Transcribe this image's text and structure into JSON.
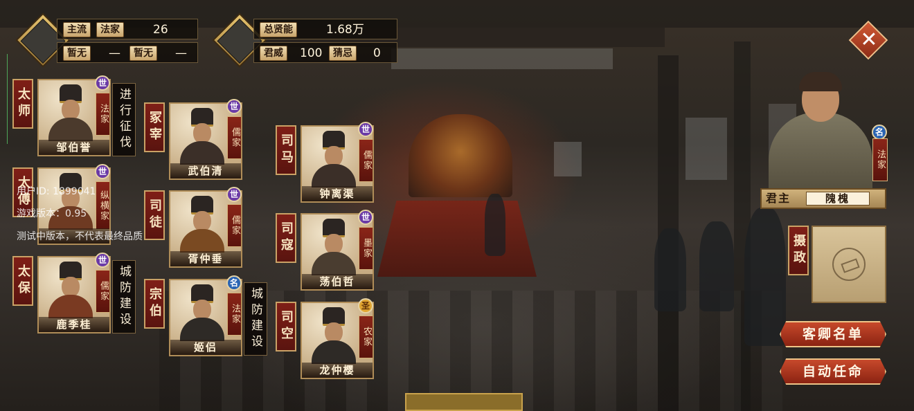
{
  "stats_left": {
    "mainstream_label": "主流",
    "mainstream_value": "法家",
    "mainstream_count": "26",
    "none1": "暂无",
    "dash1": "—",
    "none2": "暂无",
    "dash2": "—"
  },
  "stats_right": {
    "total_talent_label": "总贤能",
    "total_talent_value": "1.68万",
    "prestige_label": "君威",
    "prestige_value": "100",
    "suspicion_label": "猜忌",
    "suspicion_value": "0"
  },
  "officials": [
    {
      "title": "太师",
      "name": "邹伯誉",
      "school": "法家",
      "badge": "世",
      "task": "进行征伐"
    },
    {
      "title": "太傅",
      "name": "",
      "school": "纵横家",
      "badge": "世",
      "task": ""
    },
    {
      "title": "太保",
      "name": "鹿季桂",
      "school": "儒家",
      "badge": "世",
      "task": "城防建设"
    },
    {
      "title": "冢宰",
      "name": "武伯清",
      "school": "儒家",
      "badge": "世",
      "task": ""
    },
    {
      "title": "司徒",
      "name": "胥仲垂",
      "school": "儒家",
      "badge": "世",
      "task": ""
    },
    {
      "title": "宗伯",
      "name": "姬侣",
      "school": "法家",
      "badge": "名",
      "task": "城防建设"
    },
    {
      "title": "司马",
      "name": "钟离渠",
      "school": "儒家",
      "badge": "世",
      "task": ""
    },
    {
      "title": "司寇",
      "name": "荡伯哲",
      "school": "墨家",
      "badge": "世",
      "task": ""
    },
    {
      "title": "司空",
      "name": "龙仲樱",
      "school": "农家",
      "badge": "圣",
      "task": ""
    }
  ],
  "debug": {
    "user_id": "用户ID: 1899041",
    "version": "游戏版本：0.95",
    "notice": "测试中版本，不代表最终品质"
  },
  "lord": {
    "badge": "名",
    "school": "法家",
    "label": "君主",
    "name": "隗槐"
  },
  "regent": {
    "label": "摄政"
  },
  "buttons": {
    "guest_list": "客卿名单",
    "auto_appoint": "自动任命",
    "close": "✕"
  },
  "colors": {
    "accent_red": "#8b2312",
    "gold": "#caa266",
    "badge_purple": "#6a3aa6",
    "badge_blue": "#2a64b3",
    "badge_gold": "#e0a531"
  }
}
